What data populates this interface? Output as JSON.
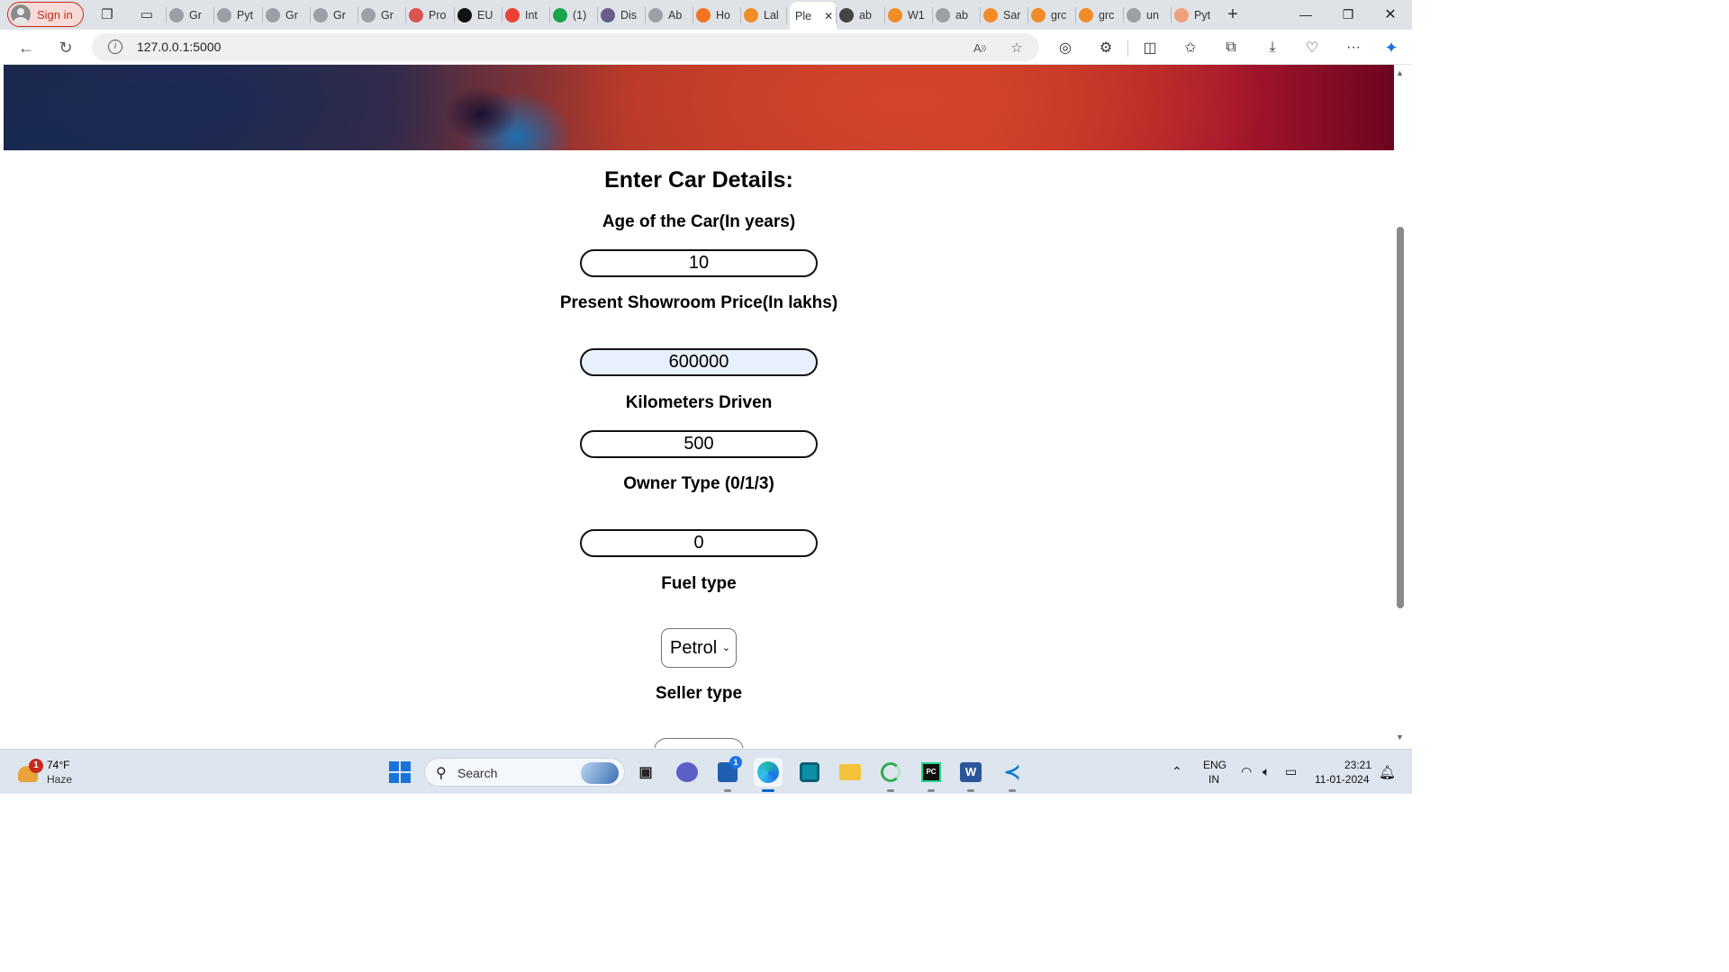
{
  "browser": {
    "signin_label": "Sign in",
    "tabs": [
      {
        "label": "Gr",
        "color": "#9aa0a6"
      },
      {
        "label": "Pyt",
        "color": "#9aa0a6"
      },
      {
        "label": "Gr",
        "color": "#9aa0a6"
      },
      {
        "label": "Gr",
        "color": "#9aa0a6"
      },
      {
        "label": "Gr",
        "color": "#9aa0a6"
      },
      {
        "label": "Pro",
        "color": "#d9534f"
      },
      {
        "label": "EU",
        "color": "#111111"
      },
      {
        "label": "Int",
        "color": "#ea4335"
      },
      {
        "label": "(1)",
        "color": "#1aa34a"
      },
      {
        "label": "Dis",
        "color": "#6a5d8a"
      },
      {
        "label": "Ab",
        "color": "#9aa0a6"
      },
      {
        "label": "Ho",
        "color": "#f47521"
      },
      {
        "label": "Lal",
        "color": "#f28c28"
      },
      {
        "label": "Ple",
        "color": "#ffffff",
        "active": true
      },
      {
        "label": "ab",
        "color": "#444444"
      },
      {
        "label": "W1",
        "color": "#f28c28"
      },
      {
        "label": "ab",
        "color": "#9aa0a6"
      },
      {
        "label": "Sar",
        "color": "#f28c28"
      },
      {
        "label": "grc",
        "color": "#f28c28"
      },
      {
        "label": "grc",
        "color": "#f28c28"
      },
      {
        "label": "un",
        "color": "#9aa0a6"
      },
      {
        "label": "Pyt",
        "color": "#f0a07a"
      }
    ],
    "url": "127.0.0.1:5000"
  },
  "page": {
    "title": "Enter Car Details:",
    "fields": {
      "age_label": "Age of the Car(In years)",
      "age_value": "10",
      "price_label": "Present Showroom Price(In lakhs)",
      "price_value": "600000",
      "km_label": "Kilometers Driven",
      "km_value": "500",
      "owner_label": "Owner Type (0/1/3)",
      "owner_value": "0",
      "fuel_label": "Fuel type",
      "fuel_selected": "Petrol",
      "seller_label": "Seller type"
    }
  },
  "taskbar": {
    "weather_badge": "1",
    "temperature": "74°F",
    "condition": "Haze",
    "search_placeholder": "Search",
    "store_badge": "1",
    "language_top": "ENG",
    "language_bottom": "IN",
    "time": "23:21",
    "date": "11-01-2024"
  },
  "colors": {
    "signin_accent": "#c42b1c",
    "autofill_bg": "#e8f0fe",
    "taskbar_bg": "#dde5ef"
  }
}
